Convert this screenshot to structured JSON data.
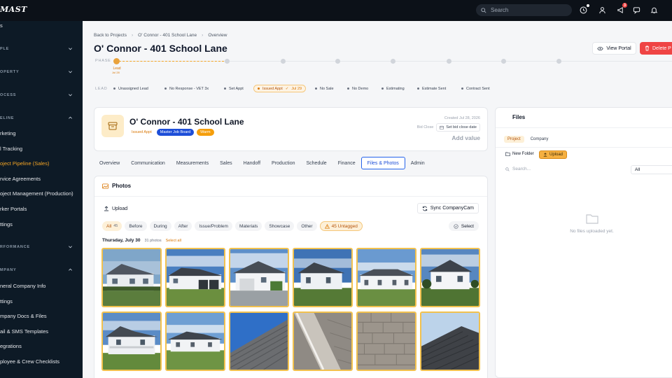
{
  "app": {
    "logo": "MAST"
  },
  "topbar": {
    "search_placeholder": "Search",
    "notification_count": "3",
    "icons": [
      "clock-icon",
      "users-icon",
      "megaphone-icon",
      "chat-icon",
      "bell-icon"
    ]
  },
  "sidebar": {
    "top_item": "s",
    "sections": [
      {
        "label": "PLE",
        "expanded": false
      },
      {
        "label": "OPERTY",
        "expanded": false
      },
      {
        "label": "OCESS",
        "expanded": false
      },
      {
        "label": "ELINE",
        "expanded": true,
        "items": [
          "rketing",
          "l Tracking",
          "oject Pipeline (Sales)",
          "rvice Agreements",
          "oject Management (Production)",
          "rker Portals",
          "ttings"
        ]
      },
      {
        "label": "RFORMANCE",
        "expanded": false
      },
      {
        "label": "MPANY",
        "expanded": true,
        "items": [
          "neral Company Info",
          "ttings",
          "mpany Docs & Files",
          "ail & SMS Templates",
          "egrations",
          "ployee & Crew Checklists"
        ]
      }
    ],
    "active_item": "oject Pipeline (Sales)"
  },
  "breadcrumb": [
    "Back to Projects",
    "O' Connor - 401 School Lane",
    "Overview"
  ],
  "page_title": "O' Connor - 401 School Lane",
  "actions": {
    "view_portal": "View Portal",
    "delete": "Delete P"
  },
  "phase": {
    "label": "PHASE",
    "active_label": "Lead",
    "active_date": "Jul 28",
    "steps_total": 8,
    "active_index": 0
  },
  "lead": {
    "label": "LEAD",
    "stages": [
      {
        "label": "Unassigned Lead",
        "active": false
      },
      {
        "label": "No Response - VET 3x",
        "active": false
      },
      {
        "label": "Set Appt",
        "active": false
      },
      {
        "label": "Issued Appt",
        "active": true,
        "date": "Jul 29"
      },
      {
        "label": "No Sale",
        "active": false
      },
      {
        "label": "No Demo",
        "active": false
      },
      {
        "label": "Estimating",
        "active": false
      },
      {
        "label": "Estimate Sent",
        "active": false
      },
      {
        "label": "Contract Sent",
        "active": false
      }
    ]
  },
  "project": {
    "title": "O' Connor - 401 School Lane",
    "status": "Issued Appt",
    "board": "Master Job Board",
    "temperature": "Warm",
    "created": "Created Jul 28, 2026",
    "bid_close_label": "Bid Close",
    "bid_close_button": "Set bid close date",
    "add_value": "Add value"
  },
  "tabs": [
    "Overview",
    "Communication",
    "Measurements",
    "Sales",
    "Handoff",
    "Production",
    "Schedule",
    "Finance",
    "Files & Photos",
    "Admin"
  ],
  "active_tab": "Files & Photos",
  "photos": {
    "title": "Photos",
    "upload": "Upload",
    "sync": "Sync CompanyCam",
    "filters": [
      {
        "label": "All",
        "count": "45",
        "active": true
      },
      {
        "label": "Before"
      },
      {
        "label": "During"
      },
      {
        "label": "After"
      },
      {
        "label": "Issue/Problem"
      },
      {
        "label": "Materials"
      },
      {
        "label": "Showcase"
      },
      {
        "label": "Other"
      }
    ],
    "untagged": "45 Untagged",
    "select": "Select",
    "group_date": "Thursday, July 30",
    "group_count": "31 photos",
    "select_all": "Select all",
    "thumbnails": [
      "house-front",
      "house-garage",
      "house-driveway",
      "house-side",
      "house-porch",
      "house-lawn",
      "house-porch-2",
      "house-wide",
      "roof-shingles-sky",
      "roof-edge",
      "roof-shingles",
      "roof-ridge"
    ]
  },
  "files": {
    "title": "Files",
    "tabs": [
      "Project",
      "Company"
    ],
    "active_tab": "Project",
    "new_folder": "New Folder",
    "upload": "Upload",
    "search_placeholder": "Search...",
    "filter_value": "All",
    "empty_message": "No files uploaded yet."
  },
  "colors": {
    "accent": "#f5a524",
    "danger": "#ef4444",
    "sidebar": "#0d1a26",
    "topbar": "#0c1118",
    "tab_active": "#2563eb"
  }
}
